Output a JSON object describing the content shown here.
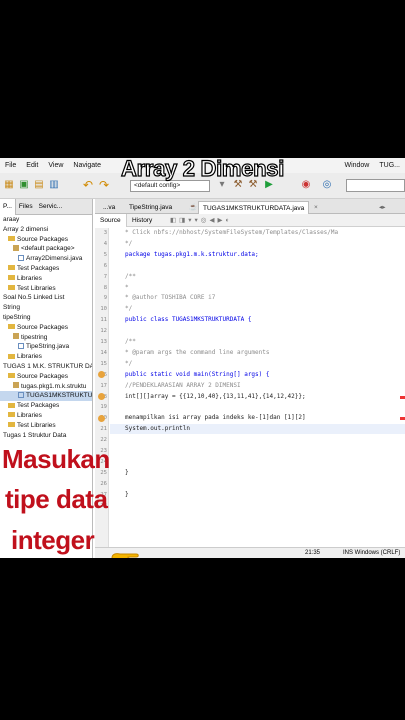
{
  "overlay": {
    "title": "Array 2 Dimensi",
    "captions": [
      "Masukan",
      "tipe data",
      "integer"
    ]
  },
  "menu": {
    "left": [
      "File",
      "Edit",
      "View",
      "Navigate"
    ],
    "right": [
      "Window",
      "TUG..."
    ]
  },
  "toolbar": {
    "config": "<default config>"
  },
  "project_panel": {
    "tabs": [
      "P...",
      "Files",
      "Servic..."
    ],
    "rows": [
      {
        "indent": 0,
        "icon": "none",
        "label": "araay"
      },
      {
        "indent": 0,
        "icon": "none",
        "label": "Array 2 dimensi"
      },
      {
        "indent": 1,
        "icon": "folder",
        "label": "Source Packages"
      },
      {
        "indent": 2,
        "icon": "package",
        "label": "<default package>"
      },
      {
        "indent": 3,
        "icon": "java",
        "label": "Array2Dimensi.java"
      },
      {
        "indent": 1,
        "icon": "folder",
        "label": "Test Packages"
      },
      {
        "indent": 1,
        "icon": "folder",
        "label": "Libraries"
      },
      {
        "indent": 1,
        "icon": "folder",
        "label": "Test Libraries"
      },
      {
        "indent": 0,
        "icon": "none",
        "label": "Soal No.5 Linked List"
      },
      {
        "indent": 0,
        "icon": "none",
        "label": "String"
      },
      {
        "indent": 0,
        "icon": "none",
        "label": "tipeString"
      },
      {
        "indent": 1,
        "icon": "folder",
        "label": "Source Packages"
      },
      {
        "indent": 2,
        "icon": "package",
        "label": "tipestring"
      },
      {
        "indent": 3,
        "icon": "java",
        "label": "TipeString.java"
      },
      {
        "indent": 1,
        "icon": "folder",
        "label": "Libraries"
      },
      {
        "indent": 0,
        "icon": "none",
        "label": "TUGAS 1 M.K. STRUKTUR DATA"
      },
      {
        "indent": 1,
        "icon": "folder",
        "label": "Source Packages"
      },
      {
        "indent": 2,
        "icon": "package",
        "label": "tugas.pkg1.m.k.struktu"
      },
      {
        "indent": 3,
        "icon": "java",
        "label": "TUGAS1MKSTRUKTUR",
        "selected": true
      },
      {
        "indent": 1,
        "icon": "folder",
        "label": "Test Packages"
      },
      {
        "indent": 1,
        "icon": "folder",
        "label": "Libraries"
      },
      {
        "indent": 1,
        "icon": "folder",
        "label": "Test Libraries"
      },
      {
        "indent": 0,
        "icon": "none",
        "label": "Tugas 1 Struktur Data"
      }
    ]
  },
  "editor": {
    "tabs": [
      "...va",
      "TipeString.java",
      "TUGAS1MKSTRUKTURDATA.java"
    ],
    "source_tab": "Source",
    "history_tab": "History",
    "status_position": "21:35",
    "status_mode": "INS  Windows (CRLF)",
    "lines": [
      {
        "n": "3",
        "text": " * Click nbfs://nbhost/SystemFileSystem/Templates/Classes/Ma",
        "style": "cmt"
      },
      {
        "n": "4",
        "text": " */",
        "style": "cmt"
      },
      {
        "n": "5",
        "text": "package tugas.pkg1.m.k.struktur.data;",
        "style": "kw"
      },
      {
        "n": "6",
        "text": "",
        "style": ""
      },
      {
        "n": "7",
        "text": "/**",
        "style": "cmt"
      },
      {
        "n": "8",
        "text": " *",
        "style": "cmt"
      },
      {
        "n": "9",
        "text": " * @author TOSHIBA CORE i7",
        "style": "cmt"
      },
      {
        "n": "10",
        "text": " */",
        "style": "cmt"
      },
      {
        "n": "11",
        "text": "public class TUGAS1MKSTRUKTURDATA {",
        "style": "kw"
      },
      {
        "n": "12",
        "text": "",
        "style": ""
      },
      {
        "n": "13",
        "text": "    /**",
        "style": "cmt"
      },
      {
        "n": "14",
        "text": "     * @param args the command line arguments",
        "style": "cmt"
      },
      {
        "n": "15",
        "text": "     */",
        "style": "cmt"
      },
      {
        "n": "16",
        "text": "    public static void main(String[] args) {",
        "style": "kw"
      },
      {
        "n": "17",
        "text": "      //PENDEKLARASIAN ARRAY 2 DIMENSI",
        "style": "cmt"
      },
      {
        "n": "18",
        "text": "      int[][]array = {{12,10,40},{13,11,41},{14,12,42}};",
        "style": ""
      },
      {
        "n": "19",
        "text": "",
        "style": ""
      },
      {
        "n": "20",
        "text": "      menampilkan isi array pada indeks ke-[1]dan [1][2]",
        "style": ""
      },
      {
        "n": "21",
        "text": "              System.out.println",
        "style": "",
        "current": true
      },
      {
        "n": "22",
        "text": "",
        "style": ""
      },
      {
        "n": "23",
        "text": "",
        "style": ""
      },
      {
        "n": "24",
        "text": "",
        "style": ""
      },
      {
        "n": "25",
        "text": "    }",
        "style": ""
      },
      {
        "n": "26",
        "text": "",
        "style": ""
      },
      {
        "n": "27",
        "text": "}",
        "style": ""
      },
      {
        "n": "28",
        "text": "",
        "style": ""
      }
    ]
  }
}
